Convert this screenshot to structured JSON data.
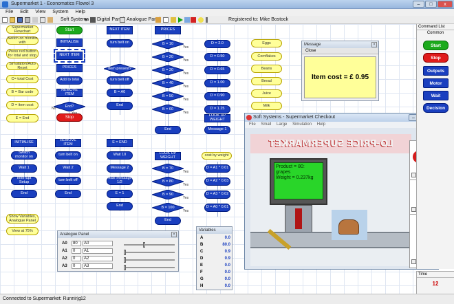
{
  "window": {
    "title": "Supermarket 1 - Economatics Flowol 3",
    "min": "–",
    "max": "□",
    "close": "x"
  },
  "menu": [
    "File",
    "Edit",
    "View",
    "System",
    "Help"
  ],
  "toolbar": {
    "soft_systems": "Soft Systems",
    "digital_panel": "Digital Panel",
    "analogue_panel": "Analogue Panel",
    "registered": "Registered to: Mike Bostock"
  },
  "canvas": {
    "notes": [
      "Supermarket Flowchart",
      "Switch on monitor with",
      "Press red button for total and stop",
      "Simulation/Auto Reset",
      "C= total Cost",
      "B = Bar code",
      "D = item cost",
      "E = End",
      "Show Variables, Analogue Panel",
      "View at 75%"
    ],
    "col1": {
      "start": "Start",
      "initialise": "INITIALISE",
      "next_item": "NEXT ITEM",
      "prices": "PRICES",
      "add_to_total": "Add to total",
      "remove_item": "REMOVE ITEM",
      "end_q": "End?",
      "stop": "Stop",
      "no": "No",
      "yes": "Yes"
    },
    "col1b": [
      "INITIALISE",
      "Switch monitor on",
      "Wait 1",
      "Interrupt Setup",
      "End"
    ],
    "col2": {
      "next_item": "NEXT ITEM",
      "turn_belt_on": "turn belt on",
      "item_present": "Item present?",
      "turn_belt_off": "turn belt off",
      "b_a0": "B = A0",
      "end": "End"
    },
    "col2b": [
      "REMOVE ITEM",
      "turn belt on",
      "Wait 2",
      "turn belt off",
      "End"
    ],
    "col3b": [
      "E = END",
      "Wait 10",
      "Message 2",
      "Hide Message 1/2",
      "E = 1",
      "End"
    ],
    "prices_header": "PRICES",
    "price_checks": [
      "B = 10",
      "B = 20",
      "B = 30",
      "B = 40",
      "B = 50",
      "B = 60"
    ],
    "price_assigns": [
      "D = 2.0",
      "D = 0.50",
      "D = 0.65",
      "D = 1.00",
      "D = 0.90",
      "D = 1.25"
    ],
    "item_labels": [
      "Eggs",
      "Cornflakes",
      "Beans",
      "Bread",
      "Juice",
      "Milk"
    ],
    "prices_tail": [
      "LOOK UP WEIGHT",
      "Message 1",
      "End"
    ],
    "weight_header": "LOOK UP WEIGHT",
    "weight_checks": [
      "B = 70",
      "B = 80",
      "B = 90",
      "B = 100"
    ],
    "weight_assigns": [
      "D = A1 * 0.01",
      "D = A2 * 0.03",
      "D = A3 * 0.02",
      "D = A0 * 0.01"
    ],
    "weight_end": "End",
    "cost_by_weight": "cost by weight",
    "yes": "Yes"
  },
  "command_list": {
    "title": "Command List",
    "common": "Common",
    "items": [
      "Start",
      "Stop",
      "Outputs",
      "Motor",
      "Wait",
      "Decision"
    ]
  },
  "time": {
    "label": "Time",
    "value": "12"
  },
  "message": {
    "title": "Message",
    "close_label": "Close",
    "text": "Item cost = £ 0.95"
  },
  "analogue": {
    "title": "Analogue Panel",
    "rows": [
      {
        "name": "A0",
        "value": "80",
        "label": "A0"
      },
      {
        "name": "A1",
        "value": "0",
        "label": "A1"
      },
      {
        "name": "A2",
        "value": "0",
        "label": "A2"
      },
      {
        "name": "A3",
        "value": "0",
        "label": "A3"
      }
    ]
  },
  "variables": {
    "title": "Variables",
    "rows": [
      {
        "name": "A",
        "value": "0.0"
      },
      {
        "name": "B",
        "value": "80.0"
      },
      {
        "name": "C",
        "value": "0.9"
      },
      {
        "name": "D",
        "value": "0.9"
      },
      {
        "name": "E",
        "value": "0.0"
      },
      {
        "name": "F",
        "value": "0.0"
      },
      {
        "name": "G",
        "value": "0.0"
      },
      {
        "name": "H",
        "value": "0.0"
      }
    ]
  },
  "simulation": {
    "title": "Soft Systems - Supermarket Checkout",
    "menu": [
      "File",
      "Small",
      "Large",
      "Simulation",
      "Help"
    ],
    "banner": "LO-PRICE SUPERMARKET",
    "product_line": "Product = 80:",
    "product_name": "grapes",
    "weight_line": "Weight = 0.237kg",
    "question": "?"
  },
  "status": {
    "connection": "Connected to Supermarket: Running",
    "count": "12"
  },
  "colors": {
    "accent_blue": "#1a3fbf",
    "note_yellow": "#ffff99",
    "start_green": "#1daa1d",
    "stop_red": "#e01b1b"
  }
}
